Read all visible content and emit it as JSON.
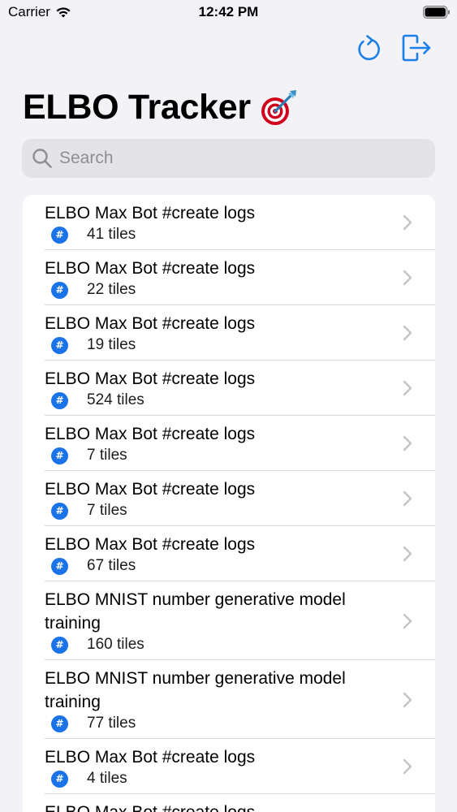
{
  "status_bar": {
    "carrier": "Carrier",
    "time": "12:42 PM"
  },
  "nav": {
    "actions": [
      "refresh-icon",
      "logout-icon"
    ],
    "accent": "#1a7fe8"
  },
  "title": {
    "text": "ELBO Tracker",
    "emoji": "🎯"
  },
  "search": {
    "placeholder": "Search",
    "value": ""
  },
  "list": {
    "items": [
      {
        "title": "ELBO Max Bot #create logs",
        "badge": "#",
        "count": "41 tiles"
      },
      {
        "title": "ELBO Max Bot #create logs",
        "badge": "#",
        "count": "22 tiles"
      },
      {
        "title": "ELBO Max Bot #create logs",
        "badge": "#",
        "count": "19 tiles"
      },
      {
        "title": "ELBO Max Bot #create logs",
        "badge": "#",
        "count": "524 tiles"
      },
      {
        "title": "ELBO Max Bot #create logs",
        "badge": "#",
        "count": "7 tiles"
      },
      {
        "title": "ELBO Max Bot #create logs",
        "badge": "#",
        "count": "7 tiles"
      },
      {
        "title": "ELBO Max Bot #create logs",
        "badge": "#",
        "count": "67 tiles"
      },
      {
        "title": "ELBO MNIST number generative model training",
        "badge": "#",
        "count": "160 tiles"
      },
      {
        "title": "ELBO MNIST number generative model training",
        "badge": "#",
        "count": "77 tiles"
      },
      {
        "title": "ELBO Max Bot #create logs",
        "badge": "#",
        "count": "4 tiles"
      },
      {
        "title": "ELBO Max Bot #create logs",
        "badge": "#",
        "count": ""
      }
    ]
  }
}
